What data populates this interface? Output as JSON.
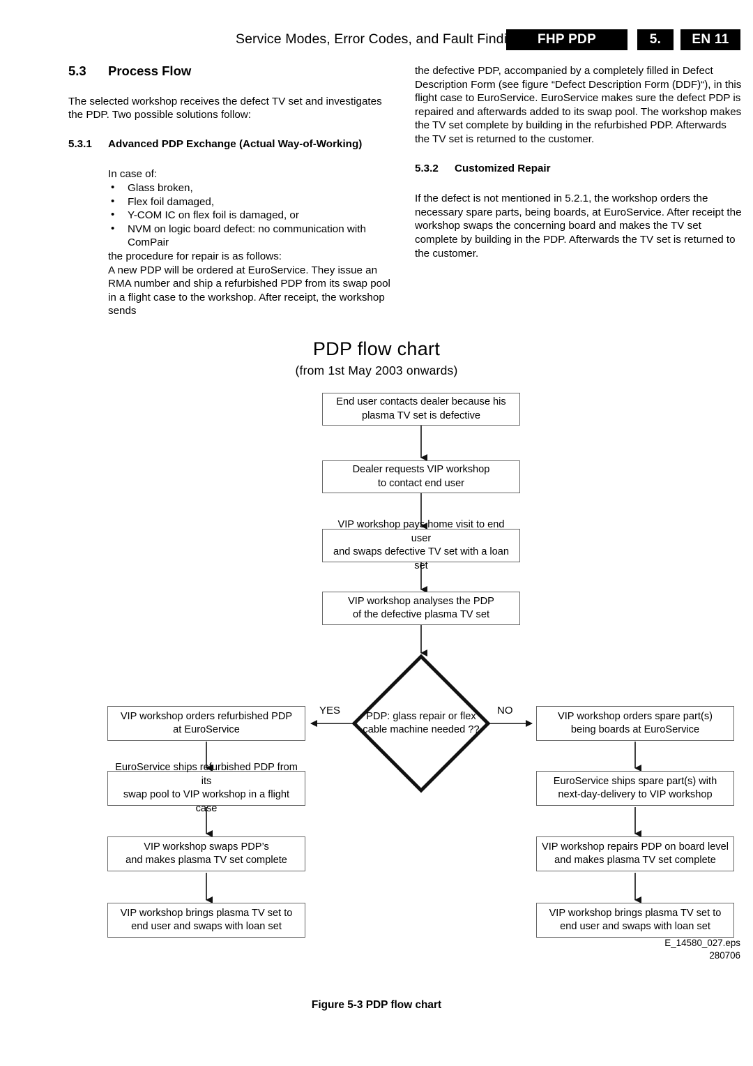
{
  "header": {
    "title": "Service Modes, Error Codes, and Fault Finding",
    "product_block": "FHP PDP",
    "chapter_block": "5.",
    "page_block": "EN 11"
  },
  "left_column": {
    "section_number": "5.3",
    "section_title": "Process Flow",
    "intro": "The selected workshop receives the defect TV set and investigates the PDP. Two possible solutions follow:",
    "subsection_number": "5.3.1",
    "subsection_title": "Advanced PDP Exchange (Actual Way-of-Working)",
    "in_case_of": "In case of:",
    "bullets": [
      {
        "text": "Glass broken,"
      },
      {
        "text": "Flex foil damaged,"
      },
      {
        "text": "Y-COM IC on flex foil is damaged, or"
      },
      {
        "text": "NVM on logic board defect: no communication with",
        "continuation": "ComPair"
      }
    ],
    "procedure_lead": "the procedure for repair is as follows:",
    "procedure_body": "A new PDP will be ordered at EuroService. They issue an RMA number and ship a refurbished PDP from its swap pool in a flight case to the workshop. After receipt, the workshop sends"
  },
  "right_column": {
    "continued_paragraph": "the defective PDP, accompanied by a completely filled in Defect Description Form (see figure “Defect Description Form (DDF)“), in this flight case to EuroService. EuroService makes sure the defect PDP is repaired and afterwards added to its swap pool. The workshop makes the TV set complete by building in the refurbished PDP. Afterwards the TV set is returned to the customer.",
    "subsection_number": "5.3.2",
    "subsection_title": "Customized Repair",
    "body": "If the defect is not mentioned in 5.2.1, the workshop orders the necessary spare parts, being boards, at EuroService. After receipt the workshop swaps the concerning board and makes the TV set complete by building in the PDP. Afterwards the TV set is returned to the customer."
  },
  "chart_data": {
    "type": "diagram",
    "title": "PDP flow  chart",
    "subtitle": "(from 1st May 2003 onwards)",
    "nodes": [
      {
        "id": "n1",
        "shape": "box",
        "lines": [
          "End user contacts dealer because his",
          "plasma TV set is defective"
        ]
      },
      {
        "id": "n2",
        "shape": "box",
        "lines": [
          "Dealer requests VIP workshop",
          "to contact end user"
        ]
      },
      {
        "id": "n3",
        "shape": "box",
        "lines": [
          "VIP workshop pays home visit to end user",
          "and swaps defective TV set with a loan set"
        ]
      },
      {
        "id": "n4",
        "shape": "box",
        "lines": [
          "VIP workshop analyses the PDP",
          "of the defective plasma TV set"
        ]
      },
      {
        "id": "d1",
        "shape": "diamond",
        "lines": [
          "PDP:",
          "glass repair",
          "or",
          "flex cable machine",
          "needed",
          "??"
        ]
      },
      {
        "id": "l1",
        "shape": "box",
        "lines": [
          "VIP workshop orders refurbished PDP",
          "at EuroService"
        ]
      },
      {
        "id": "l2",
        "shape": "box",
        "lines": [
          "EuroService ships refurbished PDP from its",
          "swap pool to VIP workshop in a flight case"
        ]
      },
      {
        "id": "l3",
        "shape": "box",
        "lines": [
          "VIP workshop swaps PDP’s",
          "and makes plasma TV set complete"
        ]
      },
      {
        "id": "l4",
        "shape": "box",
        "lines": [
          "VIP workshop brings plasma TV set to",
          "end user and swaps with loan set"
        ]
      },
      {
        "id": "r1",
        "shape": "box",
        "lines": [
          "VIP workshop orders spare part(s)",
          "being boards at EuroService"
        ]
      },
      {
        "id": "r2",
        "shape": "box",
        "lines": [
          "EuroService ships spare part(s) with",
          "next-day-delivery to VIP workshop"
        ]
      },
      {
        "id": "r3",
        "shape": "box",
        "lines": [
          "VIP workshop repairs PDP on board level",
          "and makes plasma TV set complete"
        ]
      },
      {
        "id": "r4",
        "shape": "box",
        "lines": [
          "VIP workshop brings plasma TV set to",
          "end user and swaps with loan set"
        ]
      }
    ],
    "branch_labels": {
      "yes": "YES",
      "no": "NO"
    },
    "edges": [
      {
        "from": "n1",
        "to": "n2"
      },
      {
        "from": "n2",
        "to": "n3"
      },
      {
        "from": "n3",
        "to": "n4"
      },
      {
        "from": "n4",
        "to": "d1"
      },
      {
        "from": "d1",
        "to": "l1",
        "label": "YES"
      },
      {
        "from": "d1",
        "to": "r1",
        "label": "NO"
      },
      {
        "from": "l1",
        "to": "l2"
      },
      {
        "from": "l2",
        "to": "l3"
      },
      {
        "from": "l3",
        "to": "l4"
      },
      {
        "from": "r1",
        "to": "r2"
      },
      {
        "from": "r2",
        "to": "r3"
      },
      {
        "from": "r3",
        "to": "r4"
      }
    ]
  },
  "eps_id": {
    "file": "E_14580_027.eps",
    "number": "280706"
  },
  "figure_caption": "Figure 5-3 PDP flow chart"
}
